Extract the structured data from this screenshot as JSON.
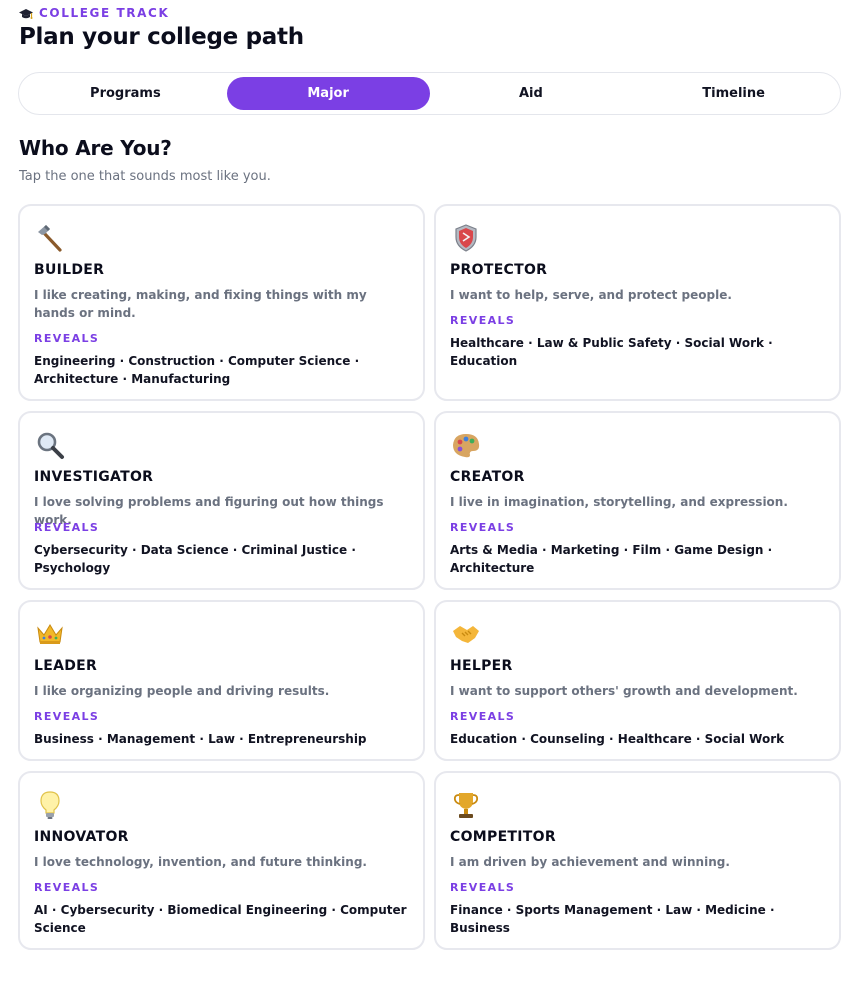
{
  "header": {
    "eyebrow_icon": "graduation-cap-icon",
    "eyebrow": "COLLEGE TRACK",
    "title": "Plan your college path"
  },
  "tabs": [
    {
      "label": "Programs",
      "active": false
    },
    {
      "label": "Major",
      "active": true
    },
    {
      "label": "Aid",
      "active": false
    },
    {
      "label": "Timeline",
      "active": false
    }
  ],
  "section": {
    "title": "Who Are You?",
    "subtitle": "Tap the one that sounds most like you."
  },
  "reveals_label": "REVEALS",
  "cards": [
    {
      "icon": "hammer-icon",
      "title": "BUILDER",
      "desc": "I like creating, making, and fixing things with my hands or mind.",
      "fields": "Engineering · Construction · Computer Science · Architecture · Manufacturing"
    },
    {
      "icon": "shield-icon",
      "title": "PROTECTOR",
      "desc": "I want to help, serve, and protect people.",
      "fields": "Healthcare · Law & Public Safety · Social Work · Education"
    },
    {
      "icon": "magnifier-icon",
      "title": "INVESTIGATOR",
      "desc": "I love solving problems and figuring out how things work.",
      "fields": "Cybersecurity · Data Science · Criminal Justice · Psychology"
    },
    {
      "icon": "palette-icon",
      "title": "CREATOR",
      "desc": "I live in imagination, storytelling, and expression.",
      "fields": "Arts & Media · Marketing · Film · Game Design · Architecture"
    },
    {
      "icon": "crown-icon",
      "title": "LEADER",
      "desc": "I like organizing people and driving results.",
      "fields": "Business · Management · Law · Entrepreneurship"
    },
    {
      "icon": "handshake-icon",
      "title": "HELPER",
      "desc": "I want to support others' growth and development.",
      "fields": "Education · Counseling · Healthcare · Social Work"
    },
    {
      "icon": "lightbulb-icon",
      "title": "INNOVATOR",
      "desc": "I love technology, invention, and future thinking.",
      "fields": "AI · Cybersecurity · Biomedical Engineering · Computer Science"
    },
    {
      "icon": "trophy-icon",
      "title": "COMPETITOR",
      "desc": "I am driven by achievement and winning.",
      "fields": "Finance · Sports Management · Law · Medicine · Business"
    }
  ]
}
